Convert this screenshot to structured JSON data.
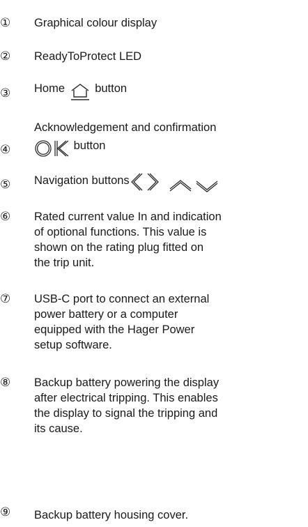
{
  "legend": [
    {
      "number": "①",
      "text": "Graphical colour display"
    },
    {
      "number": "②",
      "text": "ReadyToProtect LED"
    },
    {
      "number": "③",
      "text_before": "Home",
      "icon": "home-icon",
      "text_after": "button"
    },
    {
      "number": "④",
      "line1": "Acknowledgement and confirmation",
      "icon": "ok-icon",
      "text_after": "button"
    },
    {
      "number": "⑤",
      "text": "Navigation buttons",
      "icons": [
        "chevron-left-icon",
        "chevron-right-icon",
        "chevron-up-icon",
        "chevron-down-icon"
      ]
    },
    {
      "number": "⑥",
      "text": "Rated current value In and indication of optional functions. This value is shown on the rating plug fitted on the trip unit."
    },
    {
      "number": "⑦",
      "text": "USB-C port to connect an external power battery or a computer equipped with the Hager Power setup software."
    },
    {
      "number": "⑧",
      "text": "Backup battery powering the display after electrical tripping. This enables the display to signal the tripping and its cause."
    },
    {
      "number": "⑨",
      "text": "Backup battery housing cover."
    }
  ]
}
